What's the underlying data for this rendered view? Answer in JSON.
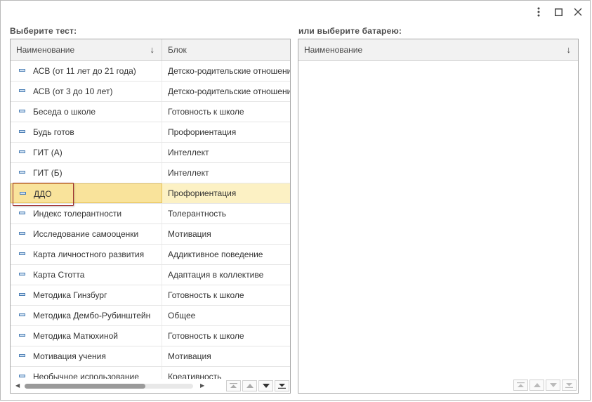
{
  "window": {
    "controls": [
      "more-icon",
      "maximize-icon",
      "close-icon"
    ]
  },
  "left": {
    "label": "Выберите тест:",
    "headers": {
      "name": "Наименование",
      "block": "Блок"
    },
    "rows": [
      {
        "name": "АСВ (от 11 лет до 21 года)",
        "block": "Детско-родительские отношения"
      },
      {
        "name": "АСВ (от 3 до 10 лет)",
        "block": "Детско-родительские отношения"
      },
      {
        "name": "Беседа о школе",
        "block": "Готовность к школе"
      },
      {
        "name": "Будь готов",
        "block": "Профориентация"
      },
      {
        "name": "ГИТ (А)",
        "block": "Интеллект"
      },
      {
        "name": "ГИТ (Б)",
        "block": "Интеллект"
      },
      {
        "name": "ДДО",
        "block": "Профориентация",
        "selected": true
      },
      {
        "name": "Индекс толерантности",
        "block": "Толерантность"
      },
      {
        "name": "Исследование самооценки",
        "block": "Мотивация"
      },
      {
        "name": "Карта личностного развития",
        "block": "Аддиктивное поведение"
      },
      {
        "name": "Карта Стотта",
        "block": "Адаптация в коллективе"
      },
      {
        "name": "Методика Гинзбург",
        "block": "Готовность к школе"
      },
      {
        "name": "Методика Дембо-Рубинштейн",
        "block": "Общее"
      },
      {
        "name": "Методика Матюхиной",
        "block": "Готовность к школе"
      },
      {
        "name": "Мотивация учения",
        "block": "Мотивация"
      },
      {
        "name": "Необычное использование",
        "block": "Креативность"
      }
    ]
  },
  "right": {
    "label": "или выберите батарею:",
    "headers": {
      "name": "Наименование"
    }
  }
}
